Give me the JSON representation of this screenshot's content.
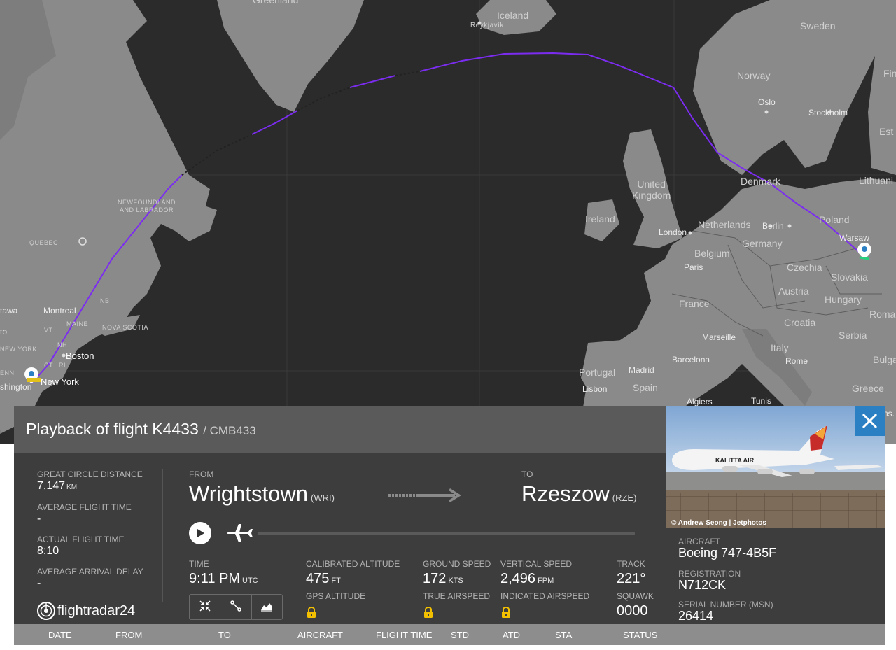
{
  "map": {
    "labels": {
      "greenland": "Greenland",
      "iceland": "Iceland",
      "reykjavik": "Reykjavík",
      "sweden": "Sweden",
      "norway": "Norway",
      "oslo": "Oslo",
      "stockholm": "Stockholm",
      "finland_partial": "Fin",
      "estonia_partial": "Est",
      "denmark": "Denmark",
      "lithuania": "Lithuani",
      "united_kingdom": "United\nKingdom",
      "ireland": "Ireland",
      "london": "London",
      "netherlands": "Netherlands",
      "berlin": "Berlin",
      "poland": "Poland",
      "warsaw": "Warsaw",
      "germany": "Germany",
      "belgium": "Belgium",
      "paris": "Paris",
      "czechia": "Czechia",
      "slovakia": "Slovakia",
      "austria": "Austria",
      "hungary": "Hungary",
      "france": "France",
      "roma": "Roma",
      "croatia": "Croatia",
      "serbia": "Serbia",
      "marseille": "Marseille",
      "italy": "Italy",
      "barcelona": "Barcelona",
      "rome": "Rome",
      "bulgaria": "Bulga",
      "portugal": "Portugal",
      "madrid": "Madrid",
      "spain": "Spain",
      "lisbon": "Lisbon",
      "greece": "Greece",
      "algiers": "Algiers",
      "tunis": "Tunis",
      "newfoundland": "NEWFOUNDLAND\nAND LABRADOR",
      "quebec": "QUEBEC",
      "ottawa": "tawa",
      "montreal": "Montreal",
      "maine": "MAINE",
      "nb": "NB",
      "nova_scotia": "NOVA SCOTIA",
      "new_york_state": "NEW YORK",
      "boston": "Boston",
      "new_york": "New York",
      "washington": "shington",
      "penn": "ENN",
      "ct": "CT",
      "nh": "NH",
      "vt": "VT",
      "ri": "RI",
      "ns_partial": "ns.",
      "google_partial": "le",
      "to_partial": "to"
    }
  },
  "panel": {
    "title": "Playback of flight K4433",
    "callsign": "/ CMB433",
    "stats": {
      "distance_label": "GREAT CIRCLE DISTANCE",
      "distance_value": "7,147",
      "distance_unit": "KM",
      "avg_flight_time_label": "AVERAGE FLIGHT TIME",
      "avg_flight_time_value": "-",
      "actual_flight_time_label": "ACTUAL FLIGHT TIME",
      "actual_flight_time_value": "8:10",
      "avg_arrival_delay_label": "AVERAGE ARRIVAL DELAY",
      "avg_arrival_delay_value": "-"
    },
    "route": {
      "from_label": "FROM",
      "from_city": "Wrightstown",
      "from_code": "(WRI)",
      "to_label": "TO",
      "to_city": "Rzeszow",
      "to_code": "(RZE)"
    },
    "playback": {
      "progress": 0.0
    },
    "telemetry": {
      "time_label": "TIME",
      "time_value": "9:11 PM",
      "time_unit": "UTC",
      "cal_alt_label": "CALIBRATED ALTITUDE",
      "cal_alt_value": "475",
      "cal_alt_unit": "FT",
      "gps_alt_label": "GPS ALTITUDE",
      "ground_speed_label": "GROUND SPEED",
      "ground_speed_value": "172",
      "ground_speed_unit": "KTS",
      "true_airspeed_label": "TRUE AIRSPEED",
      "vertical_speed_label": "VERTICAL SPEED",
      "vertical_speed_value": "2,496",
      "vertical_speed_unit": "FPM",
      "indicated_airspeed_label": "INDICATED AIRSPEED",
      "track_label": "TRACK",
      "track_value": "221°",
      "squawk_label": "SQUAWK",
      "squawk_value": "0000"
    },
    "logo": "flightradar24"
  },
  "aircraft_info": {
    "photo_credit": "© Andrew Seong | Jetphotos",
    "photo_livery": "KALITTA AIR",
    "aircraft_label": "AIRCRAFT",
    "aircraft_value": "Boeing 747-4B5F",
    "registration_label": "REGISTRATION",
    "registration_value": "N712CK",
    "serial_label": "SERIAL NUMBER (MSN)",
    "serial_value": "26414"
  },
  "table": {
    "headers": [
      "DATE",
      "FROM",
      "TO",
      "AIRCRAFT",
      "FLIGHT TIME",
      "STD",
      "ATD",
      "STA",
      "STATUS"
    ]
  },
  "colors": {
    "track": "#7b2cf0",
    "close_button": "#2b7fc3",
    "panel_dark": "#3d3d3d",
    "panel_header": "#5a5a5a",
    "table_header": "#8d8d8d"
  }
}
